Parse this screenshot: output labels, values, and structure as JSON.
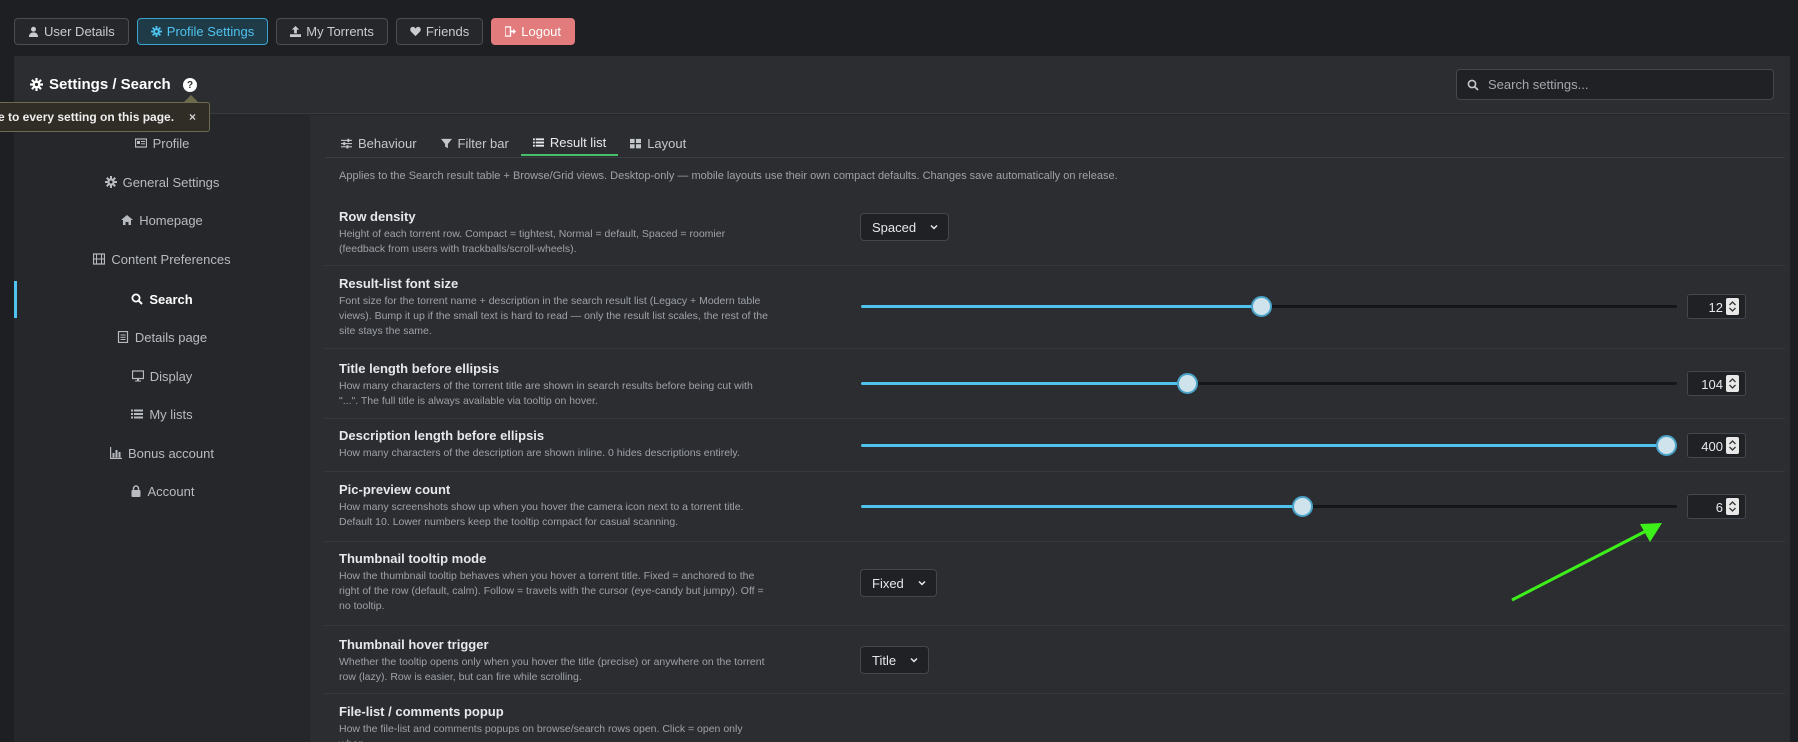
{
  "topnav": {
    "items": [
      {
        "label": "User Details",
        "icon": "user-icon"
      },
      {
        "label": "Profile Settings",
        "icon": "gear-icon",
        "active": true
      },
      {
        "label": "My Torrents",
        "icon": "upload-icon"
      },
      {
        "label": "Friends",
        "icon": "heart-icon"
      },
      {
        "label": "Logout",
        "icon": "logout-icon"
      }
    ]
  },
  "header": {
    "title": "Settings / Search",
    "help": "?",
    "search_placeholder": "Search settings..."
  },
  "tooltip": {
    "text": "e to every setting on this page.",
    "close": "×"
  },
  "sidebar": {
    "items": [
      {
        "label": "Profile",
        "icon": "id-card-icon"
      },
      {
        "label": "General Settings",
        "icon": "gear-icon"
      },
      {
        "label": "Homepage",
        "icon": "home-icon"
      },
      {
        "label": "Content Preferences",
        "icon": "film-icon"
      },
      {
        "label": "Search",
        "icon": "search-icon",
        "active": true
      },
      {
        "label": "Details page",
        "icon": "document-icon"
      },
      {
        "label": "Display",
        "icon": "monitor-icon"
      },
      {
        "label": "My lists",
        "icon": "list-icon"
      },
      {
        "label": "Bonus account",
        "icon": "bar-chart-icon"
      },
      {
        "label": "Account",
        "icon": "lock-icon"
      }
    ]
  },
  "tabs": [
    {
      "label": "Behaviour",
      "icon": "sliders-icon"
    },
    {
      "label": "Filter bar",
      "icon": "filter-icon"
    },
    {
      "label": "Result list",
      "icon": "list-icon",
      "active": true
    },
    {
      "label": "Layout",
      "icon": "grid-icon"
    }
  ],
  "intro": "Applies to the Search result table + Browse/Grid views. Desktop-only — mobile layouts use their own compact defaults. Changes save automatically on release.",
  "settings": {
    "row_density": {
      "title": "Row density",
      "desc": "Height of each torrent row. Compact = tightest, Normal = default, Spaced = roomier (feedback from users with trackballs/scroll-wheels).",
      "value": "Spaced"
    },
    "font_size": {
      "title": "Result-list font size",
      "desc": "Font size for the torrent name + description in the search result list (Legacy + Modern table views). Bump it up if the small text is hard to read — only the result list scales, the rest of the site stays the same.",
      "value": "12",
      "slider_level": 0.49
    },
    "title_length": {
      "title": "Title length before ellipsis",
      "desc": "How many characters of the torrent title are shown in search results before being cut with \"...\". The full title is always available via tooltip on hover.",
      "value": "104",
      "slider_level": 0.4
    },
    "desc_length": {
      "title": "Description length before ellipsis",
      "desc": "How many characters of the description are shown inline. 0 hides descriptions entirely.",
      "value": "400",
      "slider_level": 1.0
    },
    "pic_preview": {
      "title": "Pic-preview count",
      "desc": "How many screenshots show up when you hover the camera icon next to a torrent title. Default 10. Lower numbers keep the tooltip compact for casual scanning.",
      "value": "6",
      "slider_level": 0.54
    },
    "thumb_mode": {
      "title": "Thumbnail tooltip mode",
      "desc": "How the thumbnail tooltip behaves when you hover a torrent title. Fixed = anchored to the right of the row (default, calm). Follow = travels with the cursor (eye-candy but jumpy). Off = no tooltip.",
      "value": "Fixed"
    },
    "thumb_trigger": {
      "title": "Thumbnail hover trigger",
      "desc": "Whether the tooltip opens only when you hover the title (precise) or anywhere on the torrent row (lazy). Row is easier, but can fire while scrolling.",
      "value": "Title"
    },
    "file_list": {
      "title": "File-list / comments popup",
      "desc": "How the file-list and comments popups on browse/search rows open. Click = open only when"
    }
  },
  "colors": {
    "accent": "#4fc3ef",
    "tab_underline": "#46c06a",
    "logout": "#e27b7b",
    "annotation_arrow": "#3ef01a"
  }
}
